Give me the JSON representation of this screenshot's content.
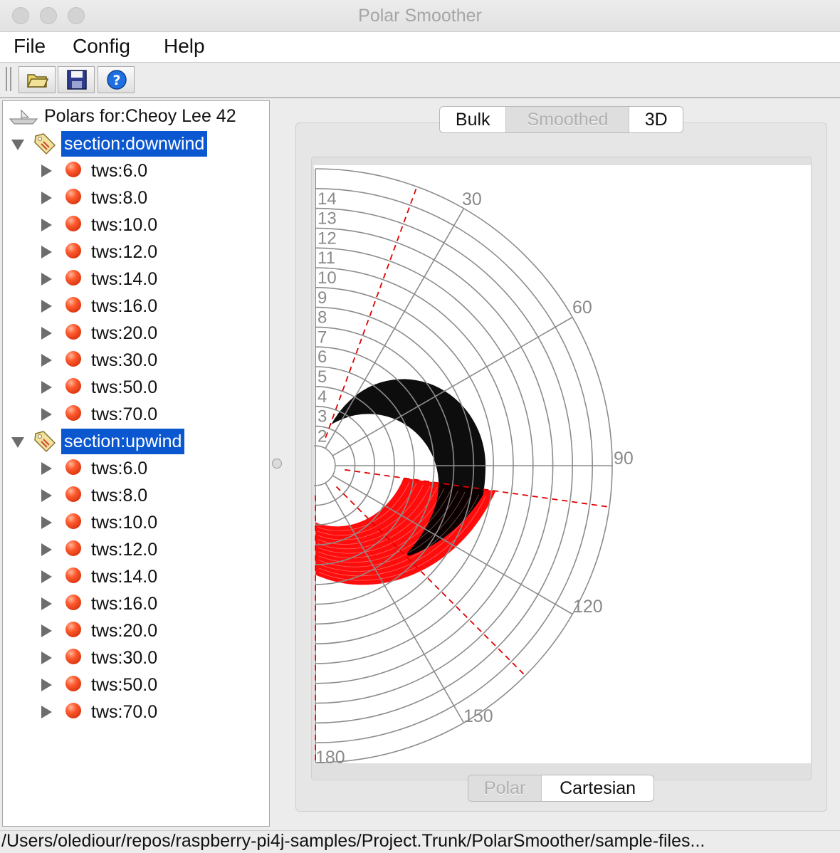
{
  "window": {
    "title": "Polar Smoother"
  },
  "menu": {
    "items": [
      "File",
      "Config",
      "Help"
    ]
  },
  "toolbar": {
    "buttons": [
      "open-folder-icon",
      "save-disk-icon",
      "help-icon"
    ]
  },
  "tree": {
    "root": "Polars for:Cheoy Lee 42",
    "sections": [
      {
        "label": "section:downwind",
        "items": [
          "tws:6.0",
          "tws:8.0",
          "tws:10.0",
          "tws:12.0",
          "tws:14.0",
          "tws:16.0",
          "tws:20.0",
          "tws:30.0",
          "tws:50.0",
          "tws:70.0"
        ]
      },
      {
        "label": "section:upwind",
        "items": [
          "tws:6.0",
          "tws:8.0",
          "tws:10.0",
          "tws:12.0",
          "tws:14.0",
          "tws:16.0",
          "tws:20.0",
          "tws:30.0",
          "tws:50.0",
          "tws:70.0"
        ]
      }
    ]
  },
  "tabs": {
    "items": [
      "Bulk",
      "Smoothed",
      "3D"
    ],
    "selected": "Smoothed"
  },
  "view_toggle": {
    "items": [
      "Polar",
      "Cartesian"
    ],
    "selected": "Polar"
  },
  "polar_chart": {
    "type": "polar",
    "radial_ticks": [
      "2",
      "3",
      "4",
      "5",
      "6",
      "7",
      "8",
      "9",
      "10",
      "11",
      "12",
      "13",
      "14"
    ],
    "angle_ticks": [
      "30",
      "60",
      "90",
      "120",
      "150",
      "180"
    ],
    "upwind_color": "#ff0000",
    "downwind_color": "#000000",
    "dashed_line_color": "#e00000",
    "dashed_angles_deg": [
      20,
      98,
      135,
      180
    ]
  },
  "statusbar": {
    "path": "/Users/olediour/repos/raspberry-pi4j-samples/Project.Trunk/PolarSmoother/sample-files..."
  }
}
